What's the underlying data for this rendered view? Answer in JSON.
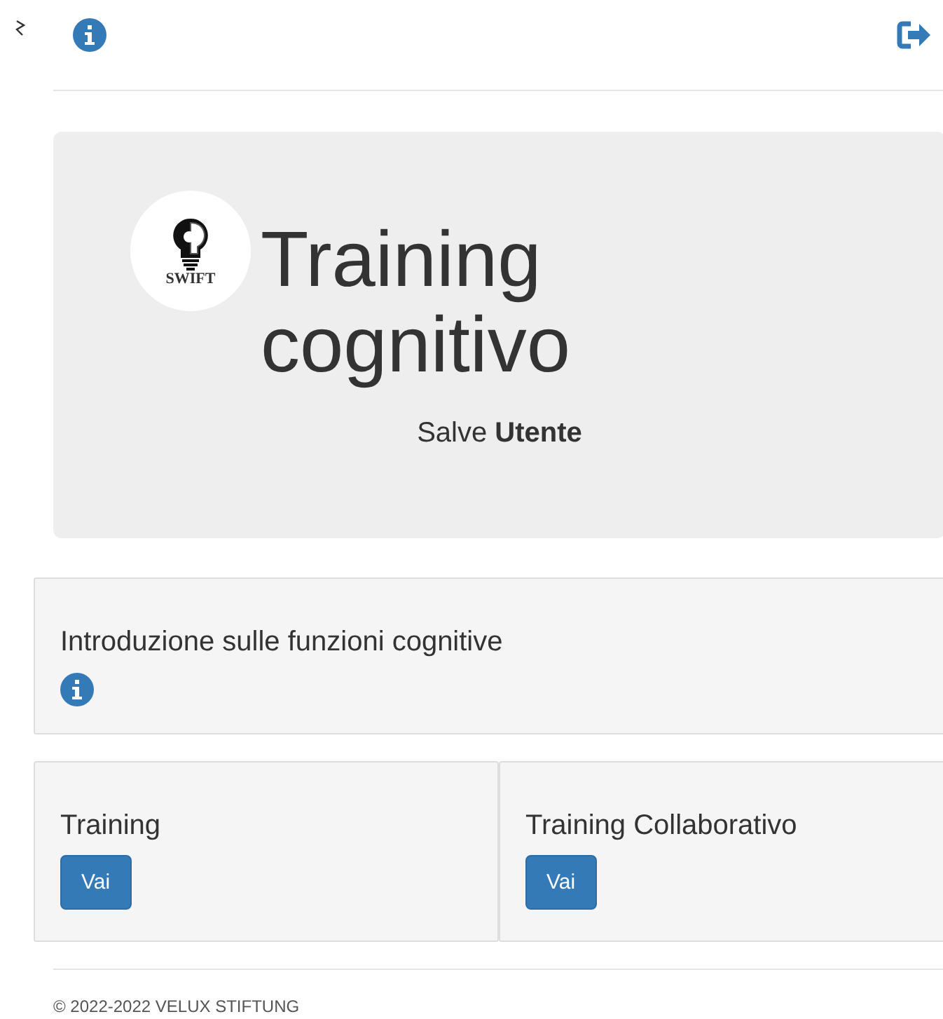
{
  "jumbotron": {
    "logo_text": "SWIFT",
    "title": "Training cognitivo",
    "greeting": "Salve **Utente**"
  },
  "intro": {
    "text": "Introduzione sulle funzioni cognitive"
  },
  "cards": [
    {
      "title": "Training",
      "button": "Vai"
    },
    {
      "title": "Training Collaborativo",
      "button": "Vai"
    }
  ],
  "footer": "© 2022-2022 VELUX STIFTUNG"
}
